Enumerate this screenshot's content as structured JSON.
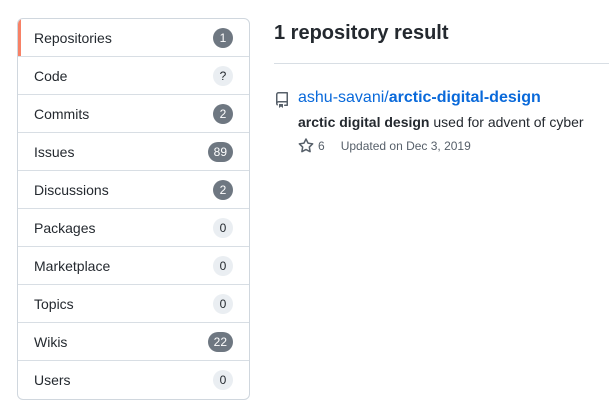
{
  "sidebar": {
    "items": [
      {
        "label": "Repositories",
        "count": "1",
        "style": "dark"
      },
      {
        "label": "Code",
        "count": "?",
        "style": "light"
      },
      {
        "label": "Commits",
        "count": "2",
        "style": "dark"
      },
      {
        "label": "Issues",
        "count": "89",
        "style": "dark"
      },
      {
        "label": "Discussions",
        "count": "2",
        "style": "dark"
      },
      {
        "label": "Packages",
        "count": "0",
        "style": "light"
      },
      {
        "label": "Marketplace",
        "count": "0",
        "style": "light"
      },
      {
        "label": "Topics",
        "count": "0",
        "style": "light"
      },
      {
        "label": "Wikis",
        "count": "22",
        "style": "dark"
      },
      {
        "label": "Users",
        "count": "0",
        "style": "light"
      }
    ]
  },
  "results": {
    "title": "1 repository result",
    "repo": {
      "owner": "ashu-savani/",
      "name": "arctic-digital-design",
      "desc_highlight": "arctic digital design",
      "desc_rest": " used for advent of cyber",
      "stars": "6",
      "updated": "Updated on Dec 3, 2019",
      "icon": "repo-icon"
    }
  },
  "colors": {
    "link": "#0969da",
    "selected_accent": "#f78166",
    "counter_dark": "#6e7781",
    "counter_light": "#eaeef2"
  }
}
